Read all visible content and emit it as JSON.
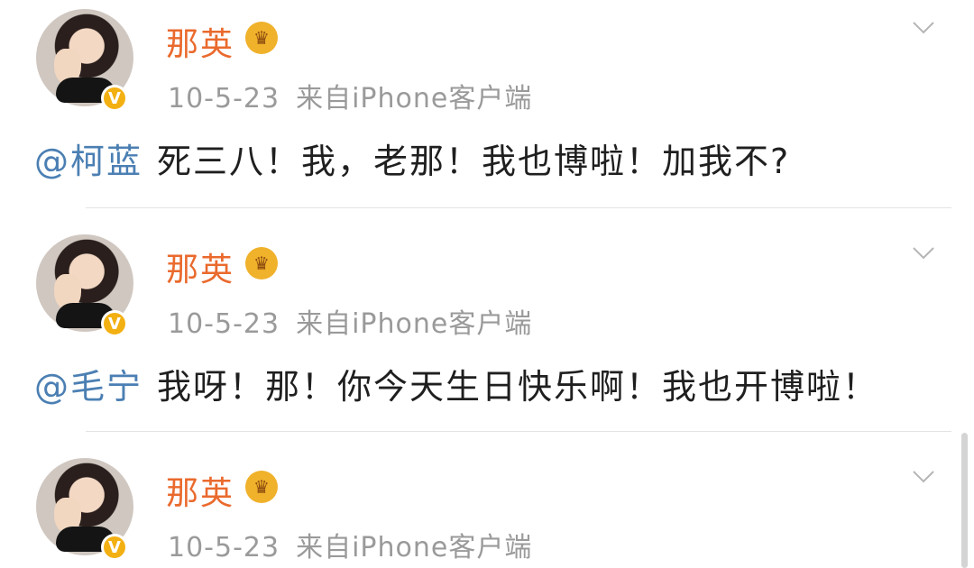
{
  "posts": [
    {
      "name": "那英",
      "date": "10-5-23",
      "source": "来自iPhone客户端",
      "mention": "@柯蓝",
      "text": "死三八！我，老那！我也博啦！加我不?"
    },
    {
      "name": "那英",
      "date": "10-5-23",
      "source": "来自iPhone客户端",
      "mention": "@毛宁",
      "text": "我呀！那！你今天生日快乐啊！我也开博啦！"
    },
    {
      "name": "那英",
      "date": "10-5-23",
      "source": "来自iPhone客户端",
      "mention": "",
      "text": ""
    }
  ],
  "icons": {
    "verified": "verified-v-badge-icon",
    "crown": "crown-vip-icon",
    "chevron": "chevron-down-icon"
  },
  "colors": {
    "name": "#ea6a2d",
    "mention": "#4b7fb3",
    "meta": "#9a9a9a",
    "badge": "#f3b012"
  }
}
